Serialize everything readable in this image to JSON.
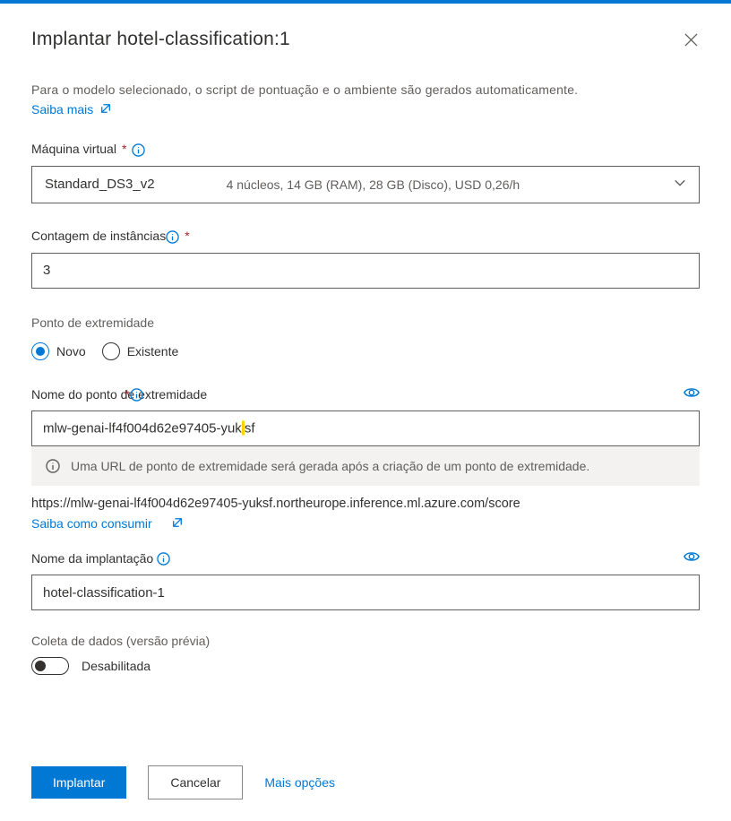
{
  "header": {
    "title": "Implantar hotel-classification:1"
  },
  "description": "Para o modelo selecionado, o script de pontuação e o ambiente são gerados automaticamente.",
  "learn_more_label": "Saiba mais",
  "vm": {
    "label": "Máquina virtual",
    "required": "*",
    "selected_name": "Standard_DS3_v2",
    "selected_spec": "4 núcleos, 14 GB (RAM), 28 GB (Disco), USD 0,26/h"
  },
  "instance_count": {
    "label": "Contagem de instâncias",
    "required": "*",
    "value": "3"
  },
  "endpoint_section": {
    "label": "Ponto de extremidade",
    "option_new": "Novo",
    "option_existing": "Existente",
    "selected": "new"
  },
  "endpoint_name": {
    "label": "Nome do ponto de extremidade",
    "required": "*",
    "value": "mlw-genai-lf4f004d62e97405-yuksf",
    "value_before_caret": "mlw-genai-lf4f004d62e97405-yuk",
    "value_after_caret": "sf"
  },
  "info_banner": "Uma URL de ponto de extremidade será gerada após a criação de um ponto de extremidade.",
  "endpoint_url": "https://mlw-genai-lf4f004d62e97405-yuksf.northeurope.inference.ml.azure.com/score",
  "consume_link_label": "Saiba como consumir",
  "deployment_name": {
    "label": "Nome da implantação",
    "value": "hotel-classification-1"
  },
  "data_collection": {
    "label": "Coleta de dados (versão prévia)",
    "state_label": "Desabilitada"
  },
  "footer": {
    "deploy_label": "Implantar",
    "cancel_label": "Cancelar",
    "more_options_label": "Mais opções"
  }
}
